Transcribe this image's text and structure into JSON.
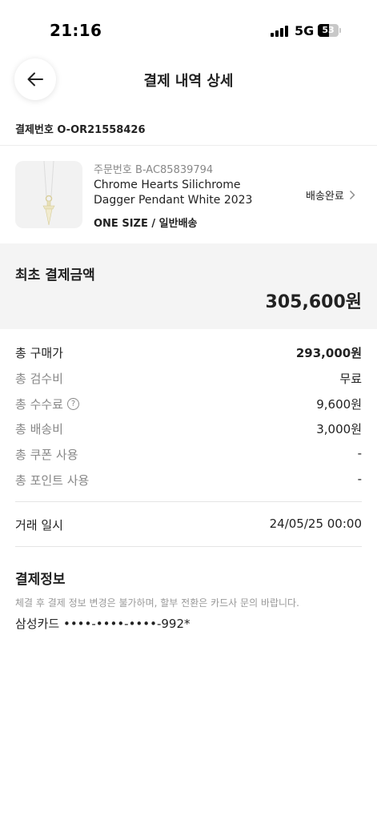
{
  "status_bar": {
    "time": "21:16",
    "network": "5G",
    "battery": "53",
    "battery_level": 0.53
  },
  "header": {
    "title": "결제 내역 상세"
  },
  "payment": {
    "label": "결제번호",
    "number": "O-OR21558426"
  },
  "order": {
    "order_no": "주문번호 B-AC85839794",
    "product_name": "Chrome Hearts Silichrome Dagger Pendant White 2023",
    "option": "ONE SIZE / 일반배송",
    "status": "배송완료"
  },
  "total": {
    "label": "최초 결제금액",
    "amount": "305,600원"
  },
  "breakdown": [
    {
      "label": "총 구매가",
      "value": "293,000원"
    },
    {
      "label": "총 검수비",
      "value": "무료"
    },
    {
      "label": "총 수수료",
      "value": "9,600원"
    },
    {
      "label": "총 배송비",
      "value": "3,000원"
    },
    {
      "label": "총 쿠폰 사용",
      "value": "-"
    },
    {
      "label": "총 포인트 사용",
      "value": "-"
    }
  ],
  "transaction": {
    "label": "거래 일시",
    "value": "24/05/25 00:00"
  },
  "payment_info": {
    "title": "결제정보",
    "notice": "체결 후 결제 정보 변경은 불가하며, 할부 전환은 카드사 문의 바랍니다.",
    "card": "삼성카드 ••••-••••-••••-992*"
  }
}
